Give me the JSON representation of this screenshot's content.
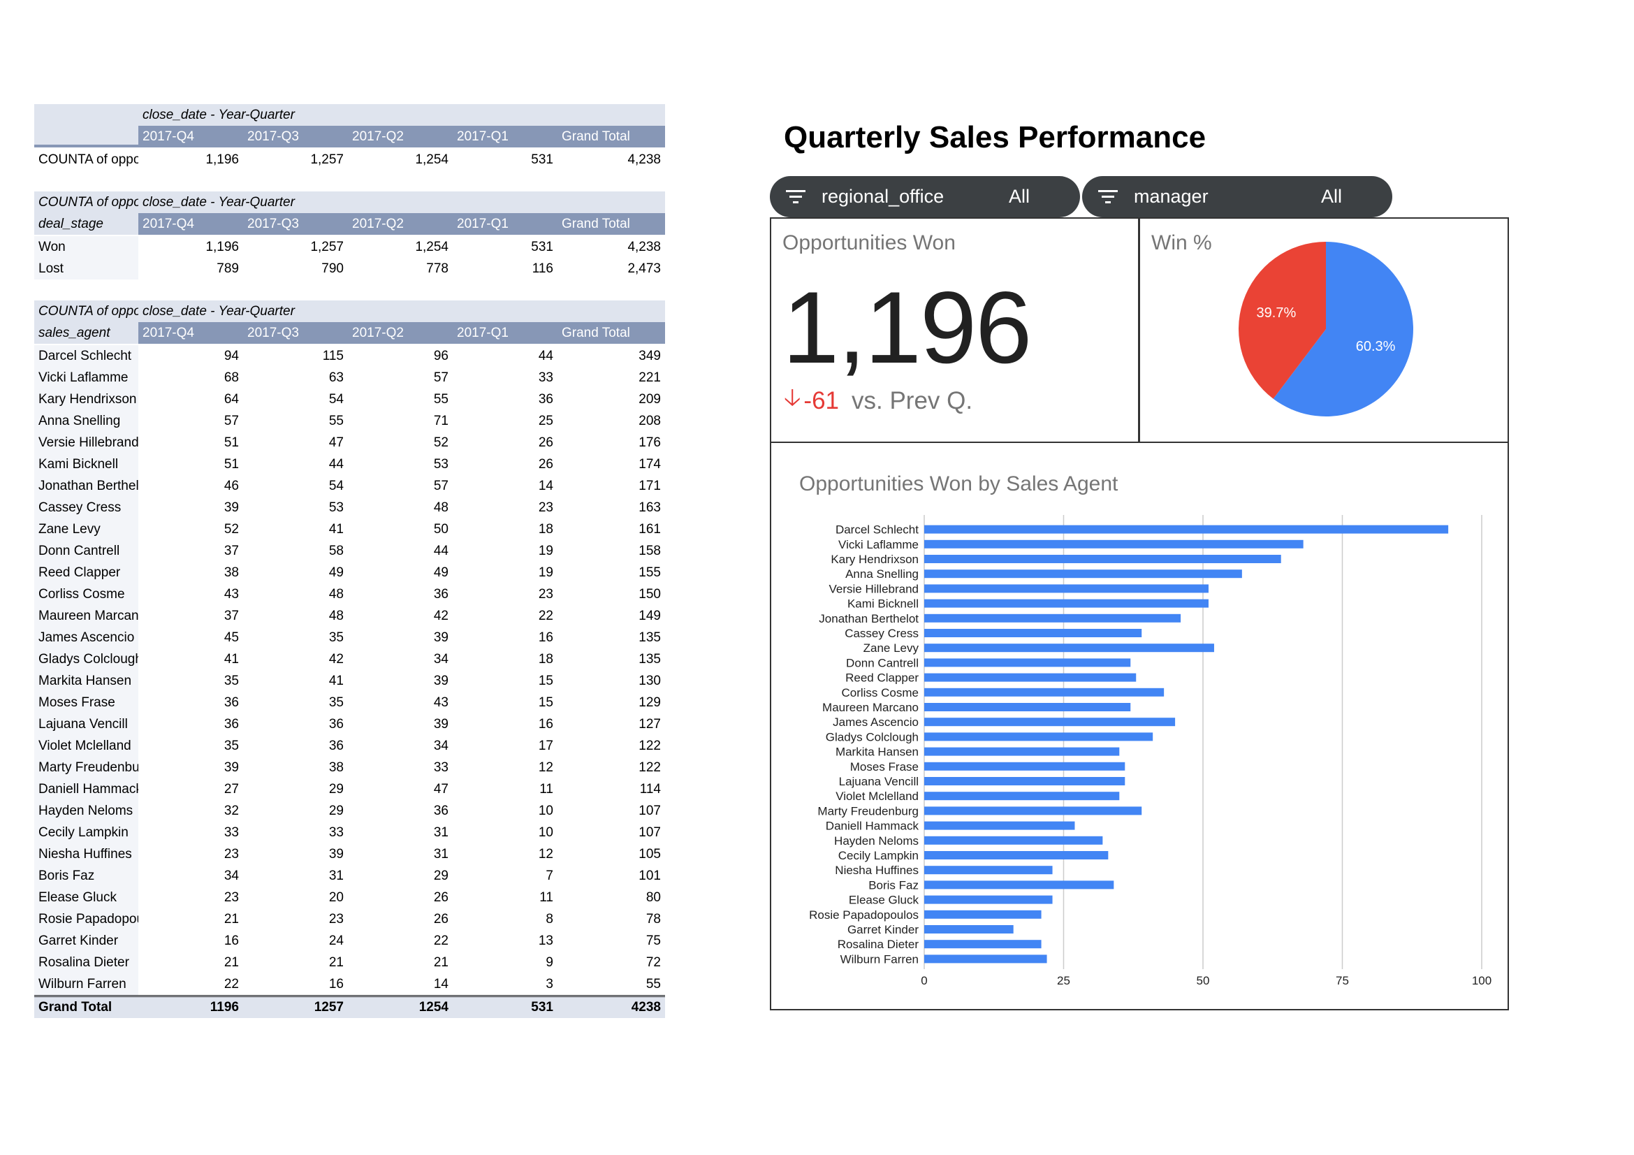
{
  "pivot1": {
    "axis_label": "close_date - Year-Quarter",
    "columns": [
      "2017-Q4",
      "2017-Q3",
      "2017-Q2",
      "2017-Q1",
      "Grand Total"
    ],
    "row": {
      "label": "COUNTA of opportunity_id",
      "values": [
        "1,196",
        "1,257",
        "1,254",
        "531",
        "4,238"
      ]
    }
  },
  "pivot2": {
    "corner_label": "COUNTA of opportunity_id",
    "axis_label": "close_date - Year-Quarter",
    "row_header": "deal_stage",
    "columns": [
      "2017-Q4",
      "2017-Q3",
      "2017-Q2",
      "2017-Q1",
      "Grand Total"
    ],
    "rows": [
      {
        "label": "Won",
        "values": [
          "1,196",
          "1,257",
          "1,254",
          "531",
          "4,238"
        ]
      },
      {
        "label": "Lost",
        "values": [
          "789",
          "790",
          "778",
          "116",
          "2,473"
        ]
      }
    ]
  },
  "pivot3": {
    "corner_label": "COUNTA of opportunity_id",
    "axis_label": "close_date - Year-Quarter",
    "row_header": "sales_agent",
    "columns": [
      "2017-Q4",
      "2017-Q3",
      "2017-Q2",
      "2017-Q1",
      "Grand Total"
    ],
    "rows": [
      {
        "label": "Darcel Schlecht",
        "values": [
          "94",
          "115",
          "96",
          "44",
          "349"
        ]
      },
      {
        "label": "Vicki Laflamme",
        "values": [
          "68",
          "63",
          "57",
          "33",
          "221"
        ]
      },
      {
        "label": "Kary Hendrixson",
        "values": [
          "64",
          "54",
          "55",
          "36",
          "209"
        ]
      },
      {
        "label": "Anna Snelling",
        "values": [
          "57",
          "55",
          "71",
          "25",
          "208"
        ]
      },
      {
        "label": "Versie Hillebrand",
        "values": [
          "51",
          "47",
          "52",
          "26",
          "176"
        ]
      },
      {
        "label": "Kami Bicknell",
        "values": [
          "51",
          "44",
          "53",
          "26",
          "174"
        ]
      },
      {
        "label": "Jonathan Berthelot",
        "values": [
          "46",
          "54",
          "57",
          "14",
          "171"
        ]
      },
      {
        "label": "Cassey Cress",
        "values": [
          "39",
          "53",
          "48",
          "23",
          "163"
        ]
      },
      {
        "label": "Zane Levy",
        "values": [
          "52",
          "41",
          "50",
          "18",
          "161"
        ]
      },
      {
        "label": "Donn Cantrell",
        "values": [
          "37",
          "58",
          "44",
          "19",
          "158"
        ]
      },
      {
        "label": "Reed Clapper",
        "values": [
          "38",
          "49",
          "49",
          "19",
          "155"
        ]
      },
      {
        "label": "Corliss Cosme",
        "values": [
          "43",
          "48",
          "36",
          "23",
          "150"
        ]
      },
      {
        "label": "Maureen Marcano",
        "values": [
          "37",
          "48",
          "42",
          "22",
          "149"
        ]
      },
      {
        "label": "James Ascencio",
        "values": [
          "45",
          "35",
          "39",
          "16",
          "135"
        ]
      },
      {
        "label": "Gladys Colclough",
        "values": [
          "41",
          "42",
          "34",
          "18",
          "135"
        ]
      },
      {
        "label": "Markita Hansen",
        "values": [
          "35",
          "41",
          "39",
          "15",
          "130"
        ]
      },
      {
        "label": "Moses Frase",
        "values": [
          "36",
          "35",
          "43",
          "15",
          "129"
        ]
      },
      {
        "label": "Lajuana Vencill",
        "values": [
          "36",
          "36",
          "39",
          "16",
          "127"
        ]
      },
      {
        "label": "Violet Mclelland",
        "values": [
          "35",
          "36",
          "34",
          "17",
          "122"
        ]
      },
      {
        "label": "Marty Freudenburg",
        "values": [
          "39",
          "38",
          "33",
          "12",
          "122"
        ]
      },
      {
        "label": "Daniell Hammack",
        "values": [
          "27",
          "29",
          "47",
          "11",
          "114"
        ]
      },
      {
        "label": "Hayden Neloms",
        "values": [
          "32",
          "29",
          "36",
          "10",
          "107"
        ]
      },
      {
        "label": "Cecily Lampkin",
        "values": [
          "33",
          "33",
          "31",
          "10",
          "107"
        ]
      },
      {
        "label": "Niesha Huffines",
        "values": [
          "23",
          "39",
          "31",
          "12",
          "105"
        ]
      },
      {
        "label": "Boris Faz",
        "values": [
          "34",
          "31",
          "29",
          "7",
          "101"
        ]
      },
      {
        "label": "Elease Gluck",
        "values": [
          "23",
          "20",
          "26",
          "11",
          "80"
        ]
      },
      {
        "label": "Rosie Papadopoulos",
        "values": [
          "21",
          "23",
          "26",
          "8",
          "78"
        ]
      },
      {
        "label": "Garret Kinder",
        "values": [
          "16",
          "24",
          "22",
          "13",
          "75"
        ]
      },
      {
        "label": "Rosalina Dieter",
        "values": [
          "21",
          "21",
          "21",
          "9",
          "72"
        ]
      },
      {
        "label": "Wilburn Farren",
        "values": [
          "22",
          "16",
          "14",
          "3",
          "55"
        ]
      }
    ],
    "total": {
      "label": "Grand Total",
      "values": [
        "1196",
        "1257",
        "1254",
        "531",
        "4238"
      ]
    }
  },
  "dashboard": {
    "title": "Quarterly Sales Performance",
    "filters": [
      {
        "name": "regional_office",
        "value": "All"
      },
      {
        "name": "manager",
        "value": "All"
      }
    ],
    "scorecard": {
      "title": "Opportunities Won",
      "value": "1,196",
      "delta": "-61",
      "delta_label": "vs. Prev Q.",
      "delta_color": "#e53935"
    },
    "win_card": {
      "title": "Win %"
    },
    "bar_card": {
      "title": "Opportunities Won by Sales Agent"
    }
  },
  "chart_data": [
    {
      "type": "pie",
      "title": "Win %",
      "slices": [
        {
          "label": "60.3%",
          "value": 60.3,
          "color": "#4285f4"
        },
        {
          "label": "39.7%",
          "value": 39.7,
          "color": "#ea4335"
        }
      ]
    },
    {
      "type": "bar",
      "orientation": "horizontal",
      "title": "Opportunities Won by Sales Agent",
      "categories": [
        "Darcel Schlecht",
        "Vicki Laflamme",
        "Kary Hendrixson",
        "Anna Snelling",
        "Versie Hillebrand",
        "Kami Bicknell",
        "Jonathan Berthelot",
        "Cassey Cress",
        "Zane Levy",
        "Donn Cantrell",
        "Reed Clapper",
        "Corliss Cosme",
        "Maureen Marcano",
        "James Ascencio",
        "Gladys Colclough",
        "Markita Hansen",
        "Moses Frase",
        "Lajuana Vencill",
        "Violet Mclelland",
        "Marty Freudenburg",
        "Daniell Hammack",
        "Hayden Neloms",
        "Cecily Lampkin",
        "Niesha Huffines",
        "Boris Faz",
        "Elease Gluck",
        "Rosie Papadopoulos",
        "Garret Kinder",
        "Rosalina Dieter",
        "Wilburn Farren"
      ],
      "values": [
        94,
        68,
        64,
        57,
        51,
        51,
        46,
        39,
        52,
        37,
        38,
        43,
        37,
        45,
        41,
        35,
        36,
        36,
        35,
        39,
        27,
        32,
        33,
        23,
        34,
        23,
        21,
        16,
        21,
        22
      ],
      "xticks": [
        0,
        25,
        50,
        75,
        100
      ],
      "xlim": [
        0,
        100
      ],
      "grid": true,
      "bar_color": "#4285f4"
    }
  ]
}
